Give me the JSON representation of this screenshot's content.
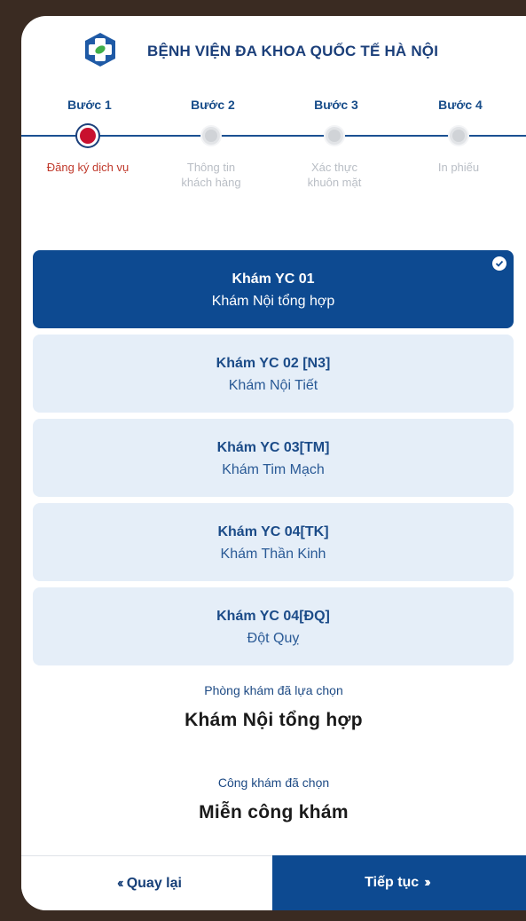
{
  "header": {
    "hospital_name": "BỆNH VIỆN ĐA KHOA QUỐC TẾ HÀ NỘI",
    "logo_icon": "hospital-cross-logo-icon"
  },
  "steps": [
    {
      "title": "Bước 1",
      "label_lines": [
        "Đăng ký dịch vụ"
      ],
      "active": true
    },
    {
      "title": "Bước 2",
      "label_lines": [
        "Thông tin",
        "khách hàng"
      ],
      "active": false
    },
    {
      "title": "Bước 3",
      "label_lines": [
        "Xác thực",
        "khuôn mặt"
      ],
      "active": false
    },
    {
      "title": "Bước 4",
      "label_lines": [
        "In phiếu"
      ],
      "active": false
    }
  ],
  "services": [
    {
      "code": "Khám YC 01",
      "name": "Khám Nội tổng hợp",
      "selected": true
    },
    {
      "code": "Khám YC 02 [N3]",
      "name": "Khám Nội Tiết",
      "selected": false
    },
    {
      "code": "Khám YC 03[TM]",
      "name": "Khám Tim Mạch",
      "selected": false
    },
    {
      "code": "Khám YC 04[TK]",
      "name": "Khám Thần Kinh",
      "selected": false
    },
    {
      "code": "Khám YC 04[ĐQ]",
      "name": "Đột Quỵ",
      "selected": false
    }
  ],
  "summary": {
    "clinic_label": "Phòng khám đã lựa chọn",
    "clinic_value": "Khám Nội tổng hợp",
    "fee_label": "Công khám đã chọn",
    "fee_value": "Miễn công khám"
  },
  "footer": {
    "back_label": "Quay lại",
    "next_label": "Tiếp tục"
  },
  "colors": {
    "primary": "#0d4a91",
    "active_step": "#c8102e",
    "card_bg": "#e5eef8"
  }
}
